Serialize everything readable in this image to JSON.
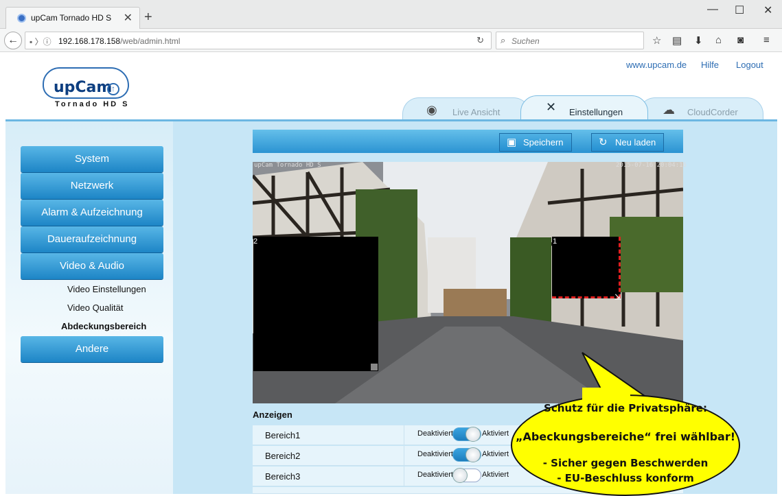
{
  "browser": {
    "tab_title": "upCam Tornado HD S",
    "new_tab": "+",
    "window_controls": [
      "—",
      "☐",
      "✕"
    ],
    "url_host": "192.168.178.158",
    "url_path": "/web/admin.html",
    "search_placeholder": "Suchen"
  },
  "header": {
    "logo_text": "upCam",
    "logo_sub": "Tornado HD S",
    "links": {
      "site": "www.upcam.de",
      "help": "Hilfe",
      "logout": "Logout"
    },
    "tabs": [
      {
        "label": "Live Ansicht",
        "active": false
      },
      {
        "label": "Einstellungen",
        "active": true
      },
      {
        "label": "CloudCorder",
        "active": false
      }
    ]
  },
  "sidebar": {
    "items": [
      "System",
      "Netzwerk",
      "Alarm & Aufzeichnung",
      "Daueraufzeichnung",
      "Video & Audio"
    ],
    "subitems": [
      {
        "label": "Video Einstellungen",
        "bold": false
      },
      {
        "label": "Video Qualität",
        "bold": false
      },
      {
        "label": "Abdeckungsbereich",
        "bold": true
      }
    ],
    "last_item": "Andere"
  },
  "toolbar": {
    "save": "Speichern",
    "reload": "Neu laden"
  },
  "camera": {
    "overlay_left": "upCam Tornado HD S",
    "overlay_right": "2015-07-16 20:04:16",
    "mask1_label": "1",
    "mask2_label": "2"
  },
  "settings": {
    "heading": "Anzeigen",
    "off_label": "Deaktiviert",
    "on_label": "Aktiviert",
    "rows": [
      {
        "name": "Bereich1",
        "enabled": true
      },
      {
        "name": "Bereich2",
        "enabled": true
      },
      {
        "name": "Bereich3",
        "enabled": false
      }
    ]
  },
  "callout": {
    "line1": "Schutz für die Privatsphäre:",
    "line2": "„Abeckungsbereiche“ frei wählbar!",
    "line3": "- Sicher gegen Beschwerden",
    "line4": "- EU-Beschluss konform"
  },
  "colors": {
    "accent": "#2d8fd0",
    "sidebar_bg": "#d7edf8",
    "callout": "#ffff00"
  }
}
